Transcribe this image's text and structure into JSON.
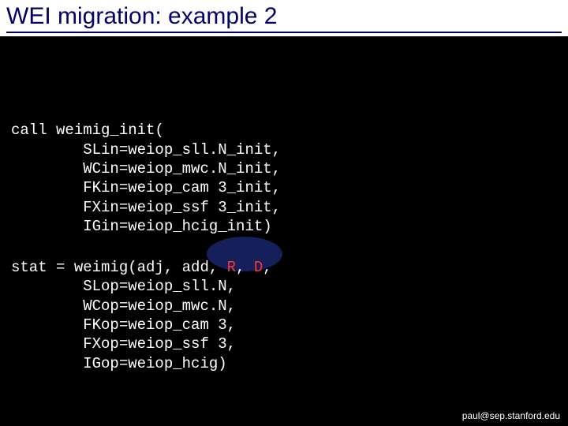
{
  "title": "WEI migration: example 2",
  "code": {
    "block1_l1": "call weimig_init(",
    "block1_l2": "        SLin=weiop_sll.N_init,",
    "block1_l3": "        WCin=weiop_mwc.N_init,",
    "block1_l4": "        FKin=weiop_cam 3_init,",
    "block1_l5": "        FXin=weiop_ssf 3_init,",
    "block1_l6": "        IGin=weiop_hcig_init)",
    "b2_pre": "stat = weimig(adj, add, ",
    "b2_R": "R",
    "b2_sep": ", ",
    "b2_D": "D",
    "b2_post": ",",
    "block2_l2": "        SLop=weiop_sll.N,",
    "block2_l3": "        WCop=weiop_mwc.N,",
    "block2_l4": "        FKop=weiop_cam 3,",
    "block2_l5": "        FXop=weiop_ssf 3,",
    "block2_l6": "        IGop=weiop_hcig)"
  },
  "footer": "paul@sep.stanford.edu"
}
